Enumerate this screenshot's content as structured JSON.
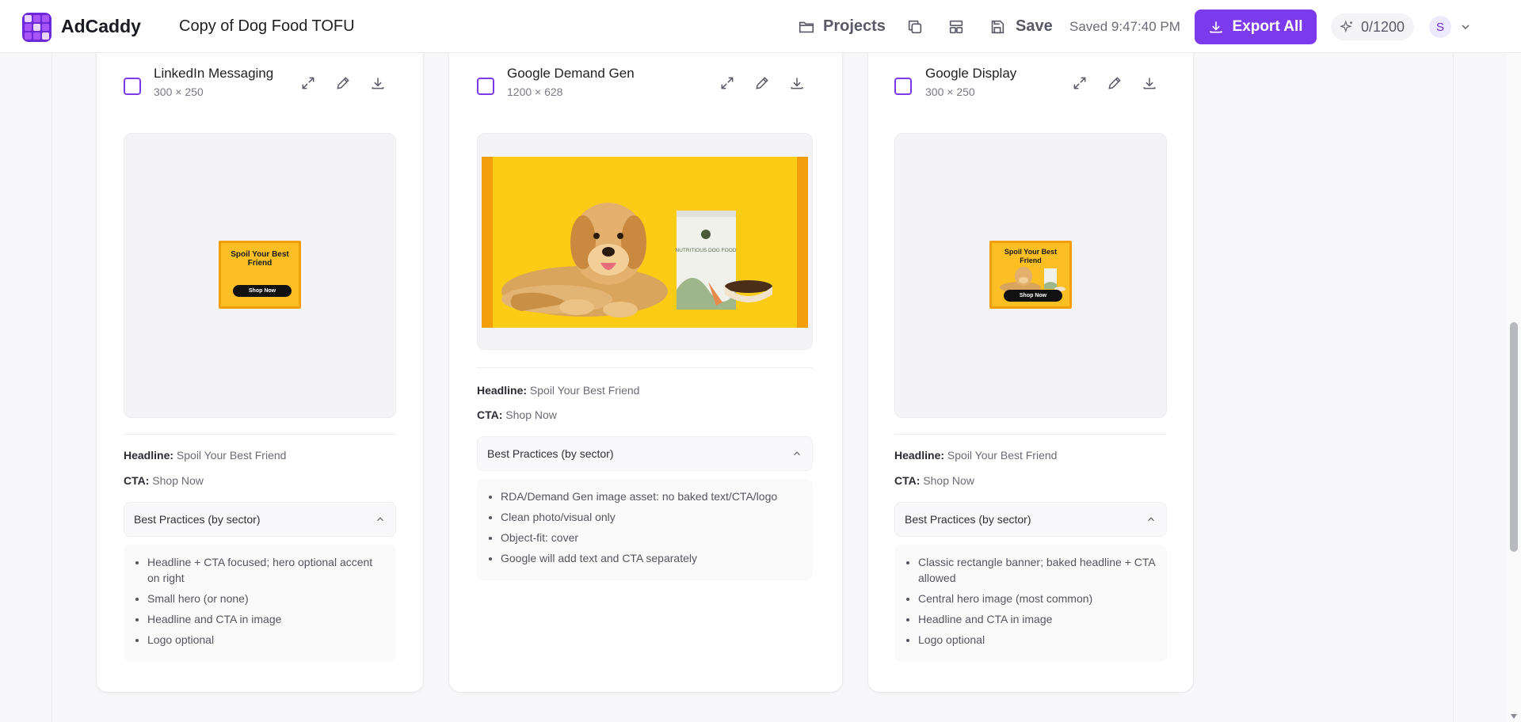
{
  "app": {
    "brand": "AdCaddy",
    "project_title": "Copy of Dog Food TOFU"
  },
  "toolbar": {
    "projects_label": "Projects",
    "save_label": "Save",
    "saved_status": "Saved 9:47:40 PM",
    "export_label": "Export All",
    "credits": "0/1200",
    "avatar_initial": "S"
  },
  "cards": [
    {
      "name": "LinkedIn Messaging",
      "size": "300 × 250",
      "ad_headline": "Spoil Your Best Friend",
      "ad_cta": "Shop Now",
      "headline_label": "Headline:",
      "headline_value": "Spoil Your Best Friend",
      "cta_label": "CTA:",
      "cta_value": "Shop Now",
      "best_practices_label": "Best Practices (by sector)",
      "best_practices": [
        "Headline + CTA focused; hero optional accent on right",
        "Small hero (or none)",
        "Headline and CTA in image",
        "Logo optional"
      ]
    },
    {
      "name": "Google Demand Gen",
      "size": "1200 × 628",
      "bag_text": "NUTRITIOUS DOG FOOD",
      "headline_label": "Headline:",
      "headline_value": "Spoil Your Best Friend",
      "cta_label": "CTA:",
      "cta_value": "Shop Now",
      "best_practices_label": "Best Practices (by sector)",
      "best_practices": [
        "RDA/Demand Gen image asset: no baked text/CTA/logo",
        "Clean photo/visual only",
        "Object-fit: cover",
        "Google will add text and CTA separately"
      ]
    },
    {
      "name": "Google Display",
      "size": "300 × 250",
      "ad_headline": "Spoil Your Best Friend",
      "ad_cta": "Shop Now",
      "headline_label": "Headline:",
      "headline_value": "Spoil Your Best Friend",
      "cta_label": "CTA:",
      "cta_value": "Shop Now",
      "best_practices_label": "Best Practices (by sector)",
      "best_practices": [
        "Classic rectangle banner; baked headline + CTA allowed",
        "Central hero image (most common)",
        "Headline and CTA in image",
        "Logo optional"
      ]
    }
  ],
  "colors": {
    "accent": "#7c3aed",
    "ad_background": "#facc15",
    "ad_border": "#f59e0b"
  }
}
